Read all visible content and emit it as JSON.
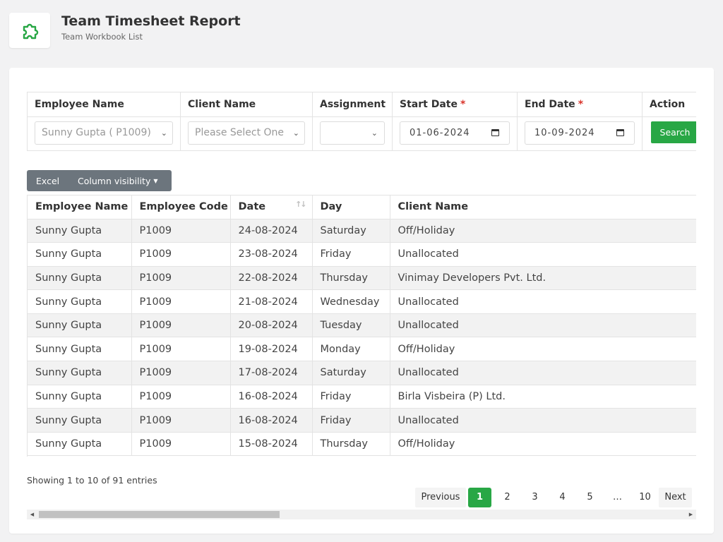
{
  "header": {
    "title": "Team Timesheet Report",
    "subtitle": "Team Workbook List",
    "logo_icon": "puzzle-icon",
    "logo_color": "#28a745"
  },
  "filters": {
    "columns": [
      "Employee Name",
      "Client Name",
      "Assignment",
      "Start Date",
      "End Date",
      "Action"
    ],
    "required_marker": "*",
    "employee_value": "Sunny Gupta ( P1009)",
    "client_placeholder": "Please Select One",
    "assignment_value": "",
    "start_date": "01-06-2024",
    "end_date": "10-09-2024",
    "search_label": "Search"
  },
  "toolbar": {
    "excel_label": "Excel",
    "column_visibility_label": "Column visibility"
  },
  "table": {
    "headers": [
      "Employee Name",
      "Employee Code",
      "Date",
      "Day",
      "Client Name"
    ],
    "rows": [
      [
        "Sunny Gupta",
        "P1009",
        "24-08-2024",
        "Saturday",
        "Off/Holiday"
      ],
      [
        "Sunny Gupta",
        "P1009",
        "23-08-2024",
        "Friday",
        "Unallocated"
      ],
      [
        "Sunny Gupta",
        "P1009",
        "22-08-2024",
        "Thursday",
        "Vinimay Developers Pvt. Ltd."
      ],
      [
        "Sunny Gupta",
        "P1009",
        "21-08-2024",
        "Wednesday",
        "Unallocated"
      ],
      [
        "Sunny Gupta",
        "P1009",
        "20-08-2024",
        "Tuesday",
        "Unallocated"
      ],
      [
        "Sunny Gupta",
        "P1009",
        "19-08-2024",
        "Monday",
        "Off/Holiday"
      ],
      [
        "Sunny Gupta",
        "P1009",
        "17-08-2024",
        "Saturday",
        "Unallocated"
      ],
      [
        "Sunny Gupta",
        "P1009",
        "16-08-2024",
        "Friday",
        "Birla Visbeira (P) Ltd."
      ],
      [
        "Sunny Gupta",
        "P1009",
        "16-08-2024",
        "Friday",
        "Unallocated"
      ],
      [
        "Sunny Gupta",
        "P1009",
        "15-08-2024",
        "Thursday",
        "Off/Holiday"
      ]
    ]
  },
  "info": "Showing 1 to 10 of 91 entries",
  "pagination": {
    "previous": "Previous",
    "next": "Next",
    "pages": [
      "1",
      "2",
      "3",
      "4",
      "5",
      "…",
      "10"
    ],
    "active": "1"
  },
  "colors": {
    "accent": "#28a745",
    "button_group": "#6c757d",
    "required": "#d9342b",
    "stripe": "#f2f2f2"
  }
}
